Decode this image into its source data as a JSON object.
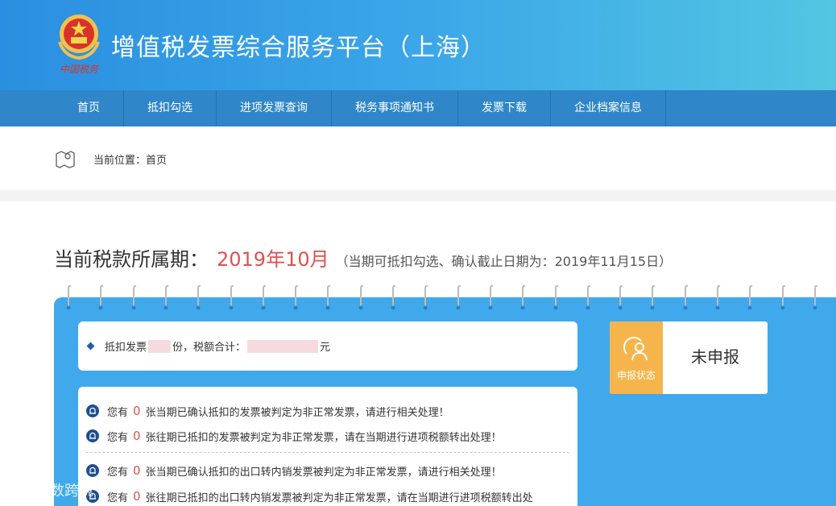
{
  "header": {
    "title": "增值税发票综合服务平台（上海）",
    "emblem_caption": "中国税务"
  },
  "nav": {
    "items": [
      {
        "label": "首页"
      },
      {
        "label": "抵扣勾选"
      },
      {
        "label": "进项发票查询"
      },
      {
        "label": "税务事项通知书"
      },
      {
        "label": "发票下载"
      },
      {
        "label": "企业档案信息"
      }
    ]
  },
  "breadcrumb": {
    "text": "当前位置：首页"
  },
  "period": {
    "label": "当前税款所属期：",
    "value": "2019年10月",
    "note": "（当期可抵扣勾选、确认截止日期为：2019年11月15日）"
  },
  "summary": {
    "prefix": "抵扣发票",
    "unit_count": "份，税额合计：",
    "unit_amount": "元"
  },
  "status": {
    "label": "申报状态",
    "value": "未申报"
  },
  "alerts": [
    {
      "prefix": "您有",
      "count": "0",
      "text": "张当期已确认抵扣的发票被判定为非正常发票，请进行相关处理！"
    },
    {
      "prefix": "您有",
      "count": "0",
      "text": "张往期已抵扣的发票被判定为非正常发票，请在当期进行进项税额转出处理！"
    },
    {
      "prefix": "您有",
      "count": "0",
      "text": "张当期已确认抵扣的出口转内销发票被判定为非正常发票，请进行相关处理！"
    },
    {
      "prefix": "您有",
      "count": "0",
      "text": "张往期已抵扣的出口转内销发票被判定为非正常发票，请在当期进行进项税额转出处"
    }
  ],
  "watermark": "大数跨境",
  "colors": {
    "header_start": "#2a8fe0",
    "header_end": "#52c6e2",
    "nav": "#2f86c8",
    "board": "#3fa9ec",
    "accent_red": "#d9534f",
    "status_orange": "#f5b54c"
  }
}
